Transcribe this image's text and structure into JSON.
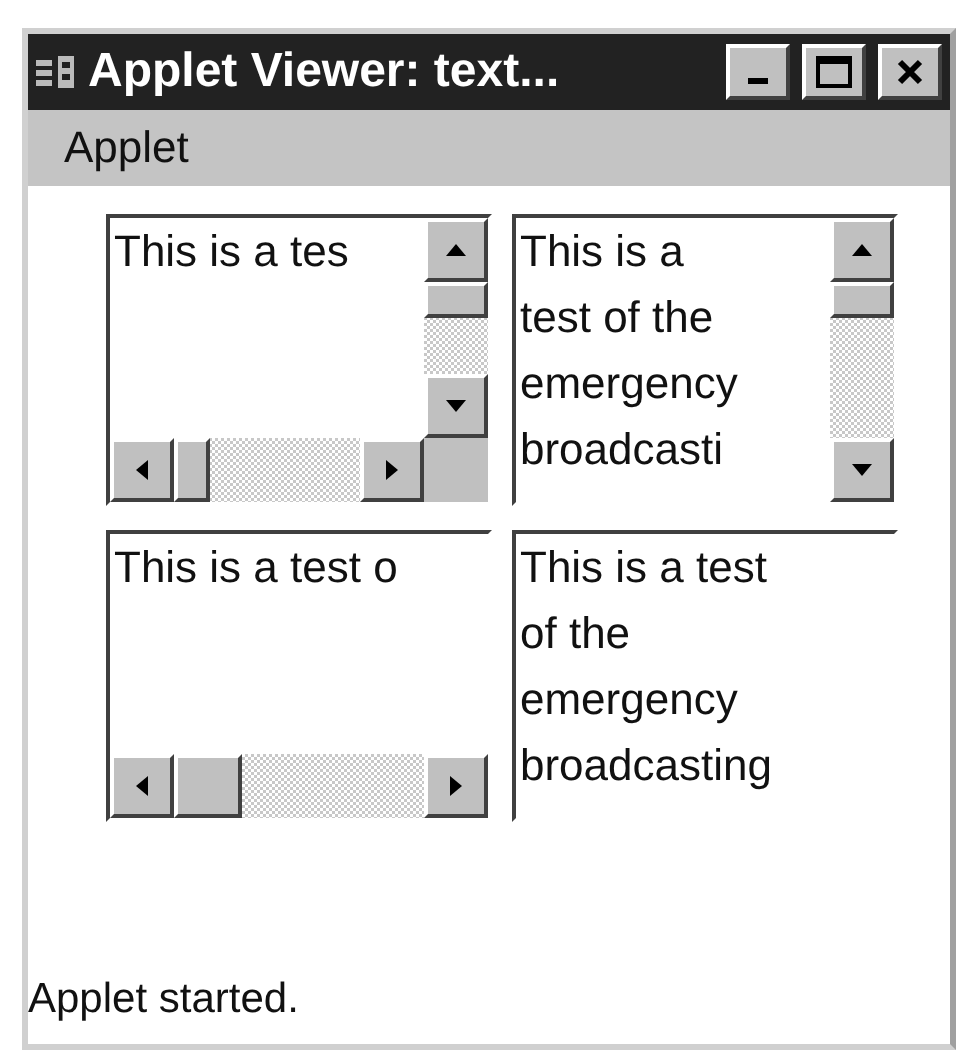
{
  "window": {
    "title": "Applet Viewer: text...",
    "menu": [
      "Applet"
    ]
  },
  "text_areas": [
    {
      "kind": "both",
      "lines": [
        "This is a tes"
      ]
    },
    {
      "kind": "vertical",
      "lines": [
        "This is a",
        "test of the",
        "emergency",
        "broadcasti"
      ]
    },
    {
      "kind": "horizontal",
      "lines": [
        "This is a test o"
      ]
    },
    {
      "kind": "none",
      "lines": [
        "This is a test",
        "of the",
        "emergency",
        "broadcasting"
      ]
    }
  ],
  "status_bar": "Applet started."
}
